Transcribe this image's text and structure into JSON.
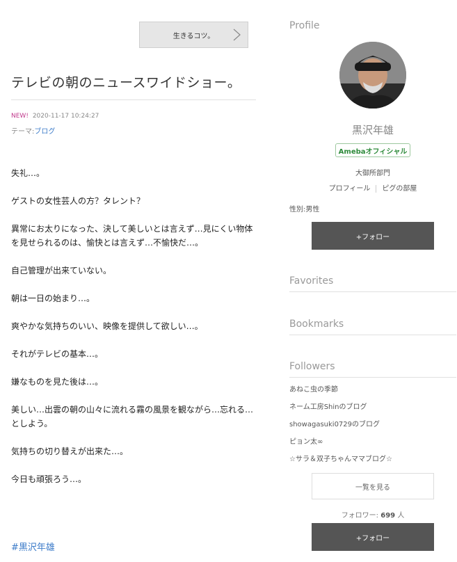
{
  "nav": {
    "next_label": "生きるコツ。"
  },
  "article": {
    "title": "テレビの朝のニュースワイドショー。",
    "new_label": "NEW!",
    "datetime": "2020-11-17 10:24:27",
    "theme_label": "テーマ:",
    "theme_value": "ブログ",
    "paragraphs": [
      "失礼…。",
      "ゲストの女性芸人の方？タレント？",
      "異常にお太りになった、決して美しいとは言えず…見にくい物体を見せられるのは、愉快とは言えず…不愉快だ…。",
      "自己管理が出来ていない。",
      "朝は一日の始まり…。",
      "爽やかな気持ちのいい、映像を提供して欲しい…。",
      "それがテレビの基本…。",
      "嫌なものを見た後は…。",
      "美しい…出雲の朝の山々に流れる霧の風景を観ながら…忘れる…としよう。",
      "気持ちの切り替えが出来た…。",
      "今日も頑張ろう…。"
    ],
    "hashtag": "#黒沢年雄"
  },
  "sidebar": {
    "profile_title": "Profile",
    "name": "黒沢年雄",
    "badge": "Amebaオフィシャル",
    "department": "大御所部門",
    "links": [
      "プロフィール",
      "ピグの部屋"
    ],
    "gender": "性別:男性",
    "follow_label": "+フォロー",
    "favorites_title": "Favorites",
    "bookmarks_title": "Bookmarks",
    "followers_title": "Followers",
    "followers": [
      "あねこ虫の季節",
      "ネーム工房Shinのブログ",
      "showagasuki0729のブログ",
      "ピョン太∞",
      "☆サラ＆双子ちゃんママブログ☆"
    ],
    "see_all_label": "一覧を見る",
    "follower_count_label": "フォロワー:",
    "follower_count": "699",
    "follower_count_unit": "人"
  },
  "colors": {
    "accent_link": "#3d7cc9",
    "new_badge": "#c0398c",
    "official_green": "#2d8a3a",
    "follow_button": "#555555"
  }
}
